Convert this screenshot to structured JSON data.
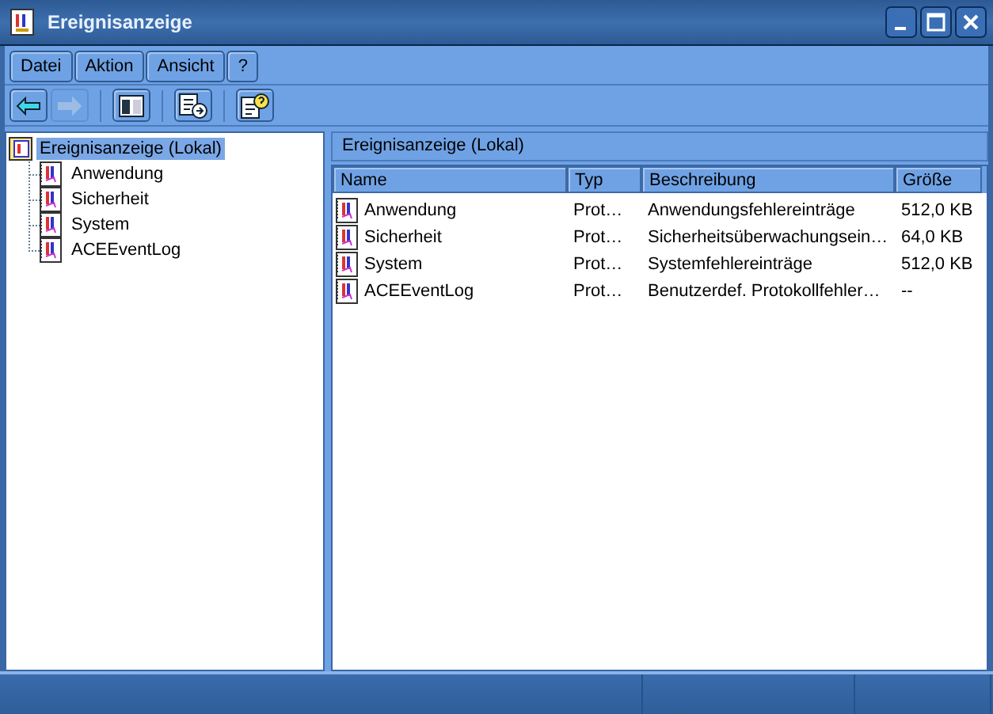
{
  "window": {
    "title": "Ereignisanzeige"
  },
  "menu": [
    "Datei",
    "Aktion",
    "Ansicht",
    "?"
  ],
  "toolbar": [
    {
      "kind": "back",
      "disabled": false
    },
    {
      "kind": "forward",
      "disabled": true
    },
    {
      "kind": "pane",
      "disabled": false
    },
    {
      "kind": "export",
      "disabled": false
    },
    {
      "kind": "help",
      "disabled": false
    }
  ],
  "tree": {
    "label": "Ereignisanzeige (Lokal)",
    "selected": true,
    "children": [
      {
        "label": "Anwendung",
        "selected": false
      },
      {
        "label": "Sicherheit",
        "selected": false
      },
      {
        "label": "System",
        "selected": false
      },
      {
        "label": "ACEEventLog",
        "selected": false
      }
    ]
  },
  "details": {
    "title": "Ereignisanzeige (Lokal)",
    "columns": [
      "Name",
      "Typ",
      "Beschreibung",
      "Größe"
    ],
    "rows": [
      {
        "name": "Anwendung",
        "type": "Prot…",
        "description": "Anwendungsfehlereinträge",
        "size": "512,0 KB"
      },
      {
        "name": "Sicherheit",
        "type": "Prot…",
        "description": "Sicherheitsüberwachungsein…",
        "size": "64,0 KB"
      },
      {
        "name": "System",
        "type": "Prot…",
        "description": "Systemfehlereinträge",
        "size": "512,0 KB"
      },
      {
        "name": "ACEEventLog",
        "type": "Prot…",
        "description": "Benutzerdef. Protokollfehler…",
        "size": "--"
      }
    ]
  }
}
